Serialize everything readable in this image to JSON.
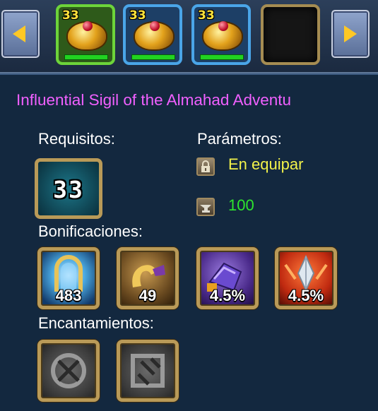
{
  "slots": [
    {
      "level": "33",
      "frame": "green"
    },
    {
      "level": "33",
      "frame": "blue"
    },
    {
      "level": "33",
      "frame": "blue"
    },
    {
      "level": "",
      "frame": "empty"
    }
  ],
  "item": {
    "title": "Influential Sigil of the Almahad Adventu"
  },
  "requirements": {
    "label": "Requisitos:",
    "level": "33"
  },
  "parameters": {
    "label": "Parámetros:",
    "binding": "En equipar",
    "durability": "100"
  },
  "bonuses": {
    "label": "Bonificaciones:",
    "items": [
      {
        "icon": "shield-defense-icon",
        "value": "483"
      },
      {
        "icon": "arm-strength-icon",
        "value": "49"
      },
      {
        "icon": "purple-gauntlet-icon",
        "value": "4.5%"
      },
      {
        "icon": "red-crystal-icon",
        "value": "4.5%"
      }
    ]
  },
  "enchantments": {
    "label": "Encantamientos:",
    "slots": [
      {
        "icon": "empty-enchant-slot-icon"
      },
      {
        "icon": "empty-enchant-slot-icon"
      }
    ]
  },
  "colors": {
    "title": "#f060ff",
    "binding": "#f2f24a",
    "durability": "#2ee62e",
    "frame_gold": "#b99a58"
  }
}
